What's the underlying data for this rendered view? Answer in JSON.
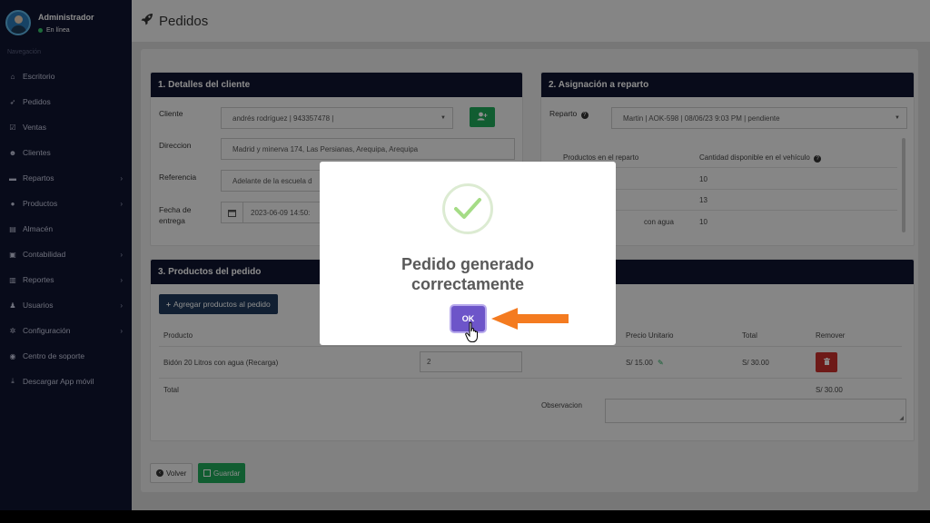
{
  "sidebar": {
    "user_name": "Administrador",
    "user_status": "En línea",
    "nav_header": "Navegación",
    "items": [
      {
        "label": "Escritorio",
        "icon": "home-icon",
        "has_submenu": false
      },
      {
        "label": "Pedidos",
        "icon": "rocket-icon",
        "has_submenu": false
      },
      {
        "label": "Ventas",
        "icon": "check-square-icon",
        "has_submenu": false
      },
      {
        "label": "Clientes",
        "icon": "users-icon",
        "has_submenu": false
      },
      {
        "label": "Repartos",
        "icon": "truck-icon",
        "has_submenu": true
      },
      {
        "label": "Productos",
        "icon": "product-icon",
        "has_submenu": true
      },
      {
        "label": "Almacén",
        "icon": "file-icon",
        "has_submenu": false
      },
      {
        "label": "Contabilidad",
        "icon": "money-icon",
        "has_submenu": true
      },
      {
        "label": "Reportes",
        "icon": "bar-chart-icon",
        "has_submenu": true
      },
      {
        "label": "Usuarios",
        "icon": "user-icon",
        "has_submenu": true
      },
      {
        "label": "Configuración",
        "icon": "gears-icon",
        "has_submenu": true
      },
      {
        "label": "Centro de soporte",
        "icon": "support-icon",
        "has_submenu": false
      },
      {
        "label": "Descargar App móvil",
        "icon": "download-icon",
        "has_submenu": false
      }
    ]
  },
  "header": {
    "title": "Pedidos"
  },
  "client_panel": {
    "title": "1. Detalles del cliente",
    "cliente_label": "Cliente",
    "cliente_value": "andrés rodríguez | 943357478 |",
    "direccion_label": "Direccion",
    "direccion_value": "Madrid y minerva 174, Las Persianas, Arequipa, Arequipa",
    "referencia_label": "Referencia",
    "referencia_value": "Adelante de la escuela d",
    "fecha_label_1": "Fecha de",
    "fecha_label_2": "entrega",
    "fecha_value": "2023-06-09 14:50:"
  },
  "reparto_panel": {
    "title": "2. Asignación a reparto",
    "reparto_label": "Reparto",
    "reparto_value": "Martin | AOK-598 | 08/06/23 9:03 PM | pendiente",
    "col_productos": "Productos en el reparto",
    "col_cantidad": "Cantidad disponible en el vehículo",
    "rows": [
      {
        "product": "",
        "qty": "10"
      },
      {
        "product": "",
        "qty": "13"
      },
      {
        "product": "con agua",
        "qty": "10"
      }
    ]
  },
  "products_panel": {
    "title": "3. Productos del pedido",
    "add_button": "Agregar productos al pedido",
    "col_producto": "Producto",
    "col_precio": "Precio Unitario",
    "col_total": "Total",
    "col_remover": "Remover",
    "row_product": "Bidón 20 Litros con agua (Recarga)",
    "row_qty": "2",
    "row_price": "S/ 15.00",
    "row_total": "S/ 30.00",
    "total_label": "Total",
    "total_value": "S/ 30.00",
    "observacion_label": "Observacion"
  },
  "footer_buttons": {
    "volver": "Volver",
    "guardar": "Guardar"
  },
  "modal": {
    "title_line1": "Pedido generado",
    "title_line2": "correctamente",
    "ok_label": "OK"
  },
  "colors": {
    "sidebar_bg": "#0f1430",
    "accent_purple": "#6d55c9",
    "success_green": "#1faa59",
    "arrow_orange": "#f47b20"
  }
}
